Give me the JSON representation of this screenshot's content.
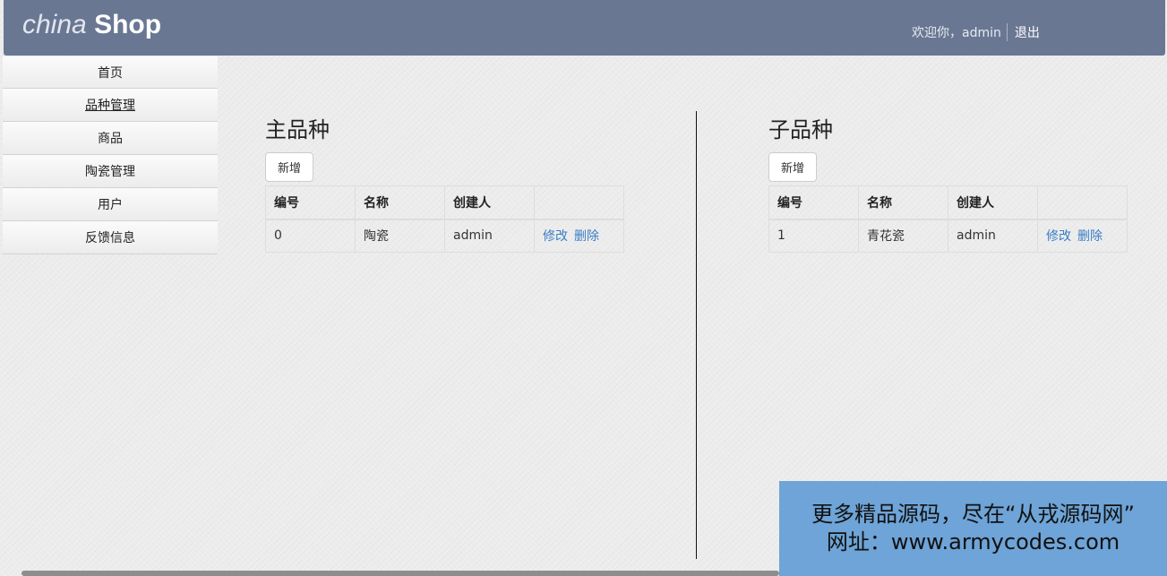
{
  "header": {
    "brand_part1": "china",
    "brand_part2": "Shop",
    "welcome": "欢迎你，admin",
    "logout": "退出"
  },
  "sidebar": {
    "items": [
      {
        "label": "首页"
      },
      {
        "label": "品种管理"
      },
      {
        "label": "商品"
      },
      {
        "label": "陶瓷管理"
      },
      {
        "label": "用户"
      },
      {
        "label": "反馈信息"
      }
    ]
  },
  "main_category": {
    "title": "主品种",
    "new_button": "新增",
    "columns": [
      "编号",
      "名称",
      "创建人",
      ""
    ],
    "rows": [
      {
        "id": "0",
        "name": "陶瓷",
        "creator": "admin",
        "edit": "修改",
        "delete": "删除"
      }
    ]
  },
  "sub_category": {
    "title": "子品种",
    "new_button": "新增",
    "columns": [
      "编号",
      "名称",
      "创建人",
      ""
    ],
    "rows": [
      {
        "id": "1",
        "name": "青花瓷",
        "creator": "admin",
        "edit": "修改",
        "delete": "删除"
      }
    ]
  },
  "promo": {
    "line1": "更多精品源码，尽在“从戎源码网”",
    "line2": "网址：www.armycodes.com"
  },
  "colors": {
    "navbar": "#6a7793",
    "link": "#3b7dc4",
    "promo_bg": "#6ea4d7"
  }
}
